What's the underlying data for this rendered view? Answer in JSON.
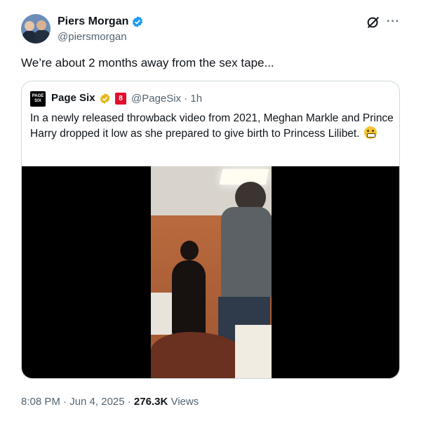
{
  "author": {
    "name": "Piers Morgan",
    "handle": "@piersmorgan"
  },
  "tweet": {
    "text": "We’re about 2 months away from the sex tape..."
  },
  "quoted": {
    "name": "Page Six",
    "avatar_text": "PAGE SIX",
    "affiliate_badge": "8",
    "handle_time": "@PageSix · 1h",
    "text": "In a newly released throwback video from 2021, Meghan Markle and Prince Harry dropped it low as she prepared to give birth to Princess Lilibet."
  },
  "meta": {
    "time": "8:08 PM · Jun 4, 2025 · ",
    "views_count": "276.3K",
    "views_label": " Views"
  },
  "colors": {
    "verified_blue": "#1d9bf0",
    "gold_badge": "#e2b719",
    "text_secondary": "#536471"
  },
  "icons": [
    "verified-badge-icon",
    "grok-icon",
    "more-icon",
    "gold-verified-badge-icon",
    "affiliate-badge-icon",
    "grimacing-emoji-icon"
  ]
}
